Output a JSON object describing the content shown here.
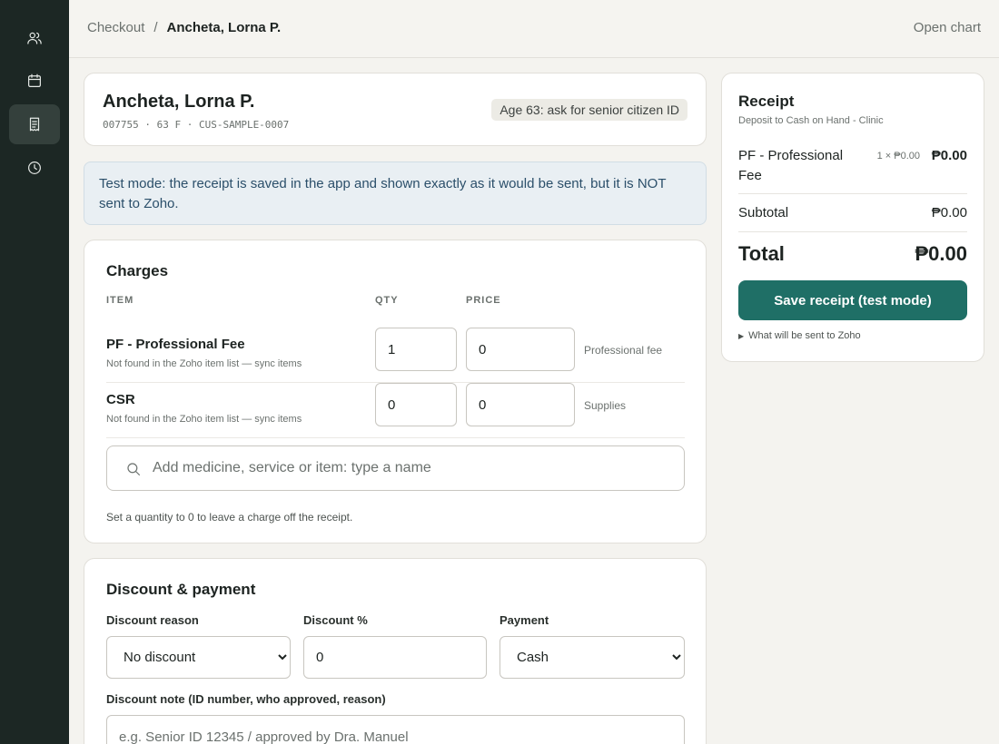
{
  "sidebar": {
    "items": [
      {
        "icon": "users-icon"
      },
      {
        "icon": "calendar-icon"
      },
      {
        "icon": "receipt-icon",
        "active": true
      },
      {
        "icon": "clock-icon"
      }
    ]
  },
  "header": {
    "breadcrumb_root": "Checkout",
    "breadcrumb_sep": "/",
    "breadcrumb_current": "Ancheta, Lorna P.",
    "open_chart": "Open chart"
  },
  "patient": {
    "name": "Ancheta, Lorna P.",
    "meta": "007755 · 63 F · CUS-SAMPLE-0007",
    "age_badge": "Age 63: ask for senior citizen ID"
  },
  "banner": "Test mode: the receipt is saved in the app and shown exactly as it would be sent, but it is NOT sent to Zoho.",
  "charges": {
    "title": "Charges",
    "col_item": "ITEM",
    "col_qty": "QTY",
    "col_price": "PRICE",
    "rows": [
      {
        "name": "PF - Professional Fee",
        "note": "Not found in the Zoho item list — sync items",
        "qty": "1",
        "price": "0",
        "kind": "Professional fee"
      },
      {
        "name": "CSR",
        "note": "Not found in the Zoho item list — sync items",
        "qty": "0",
        "price": "0",
        "kind": "Supplies"
      }
    ],
    "search_placeholder": "Add medicine, service or item: type a name",
    "hint": "Set a quantity to 0 to leave a charge off the receipt."
  },
  "discount": {
    "title": "Discount & payment",
    "reason_label": "Discount reason",
    "reason_value": "No discount",
    "percent_label": "Discount %",
    "percent_value": "0",
    "payment_label": "Payment",
    "payment_value": "Cash",
    "note_label": "Discount note (ID number, who approved, reason)",
    "note_placeholder": "e.g. Senior ID 12345 / approved by Dra. Manuel"
  },
  "receipt": {
    "title": "Receipt",
    "subtitle": "Deposit to Cash on Hand - Clinic",
    "item_name": "PF - Professional Fee",
    "item_qty": "1 × ₱0.00",
    "item_amount": "₱0.00",
    "subtotal_label": "Subtotal",
    "subtotal_value": "₱0.00",
    "total_label": "Total",
    "total_value": "₱0.00",
    "save_button": "Save receipt (test mode)",
    "details_toggle": "What will be sent to Zoho"
  },
  "colors": {
    "sidebar_bg": "#1c2724",
    "accent": "#1f6f66",
    "banner_bg": "#e9eff3"
  }
}
